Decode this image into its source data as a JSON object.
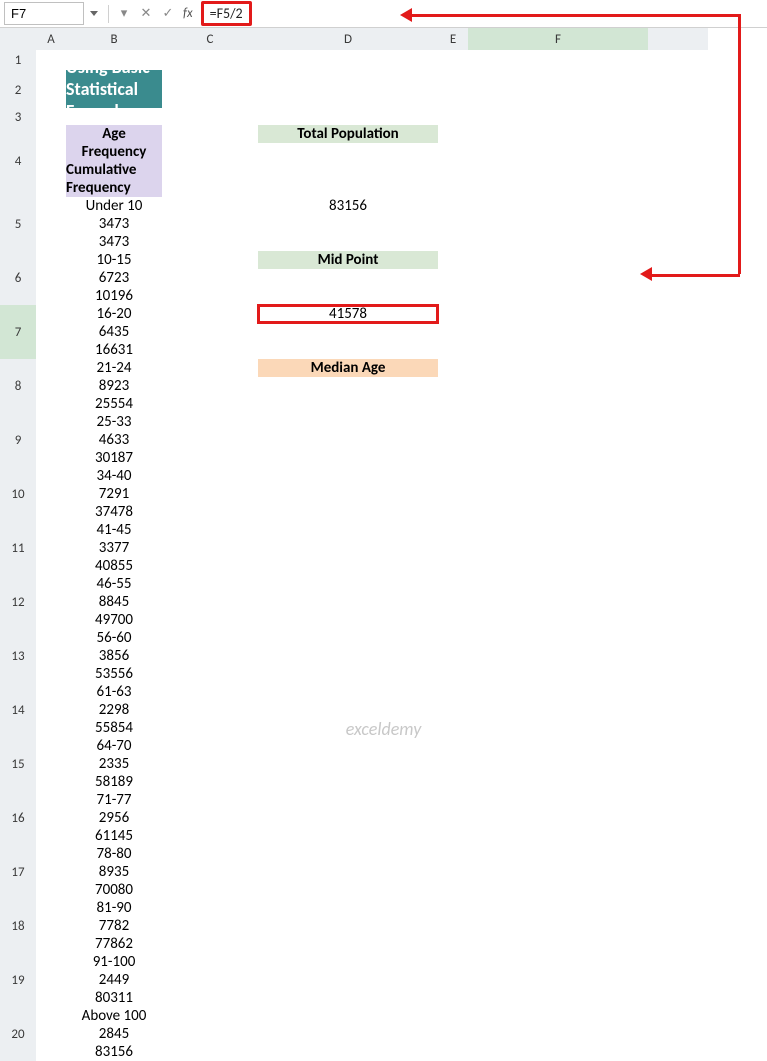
{
  "namebox": "F7",
  "formula": "=F5/2",
  "fx_label": "fx",
  "col_headers": [
    "A",
    "B",
    "C",
    "D",
    "E",
    "F"
  ],
  "row_headers": [
    "1",
    "2",
    "3",
    "4",
    "5",
    "6",
    "7",
    "8",
    "9",
    "10",
    "11",
    "12",
    "13",
    "14",
    "15",
    "16",
    "17",
    "18",
    "19",
    "20"
  ],
  "title": "Using Basic Statistical Formula",
  "table_headers": {
    "age": "Age",
    "freq": "Frequency",
    "cum": "Cumulative Frequency"
  },
  "rows": [
    {
      "age": "Under 10",
      "freq": "3473",
      "cum": "3473"
    },
    {
      "age": "10-15",
      "freq": "6723",
      "cum": "10196"
    },
    {
      "age": "16-20",
      "freq": "6435",
      "cum": "16631"
    },
    {
      "age": "21-24",
      "freq": "8923",
      "cum": "25554"
    },
    {
      "age": "25-33",
      "freq": "4633",
      "cum": "30187"
    },
    {
      "age": "34-40",
      "freq": "7291",
      "cum": "37478"
    },
    {
      "age": "41-45",
      "freq": "3377",
      "cum": "40855"
    },
    {
      "age": "46-55",
      "freq": "8845",
      "cum": "49700"
    },
    {
      "age": "56-60",
      "freq": "3856",
      "cum": "53556"
    },
    {
      "age": "61-63",
      "freq": "2298",
      "cum": "55854"
    },
    {
      "age": "64-70",
      "freq": "2335",
      "cum": "58189"
    },
    {
      "age": "71-77",
      "freq": "2956",
      "cum": "61145"
    },
    {
      "age": "78-80",
      "freq": "8935",
      "cum": "70080"
    },
    {
      "age": "81-90",
      "freq": "7782",
      "cum": "77862"
    },
    {
      "age": "91-100",
      "freq": "2449",
      "cum": "80311"
    },
    {
      "age": "Above 100",
      "freq": "2845",
      "cum": "83156"
    }
  ],
  "side": {
    "total_pop_label": "Total Population",
    "total_pop_value": "83156",
    "mid_point_label": "Mid Point",
    "mid_point_value": "41578",
    "median_age_label": "Median Age",
    "median_age_value": ""
  },
  "watermark": "exceldemy",
  "icons": {
    "check": "✓",
    "x": "✕",
    "dd": "▾"
  }
}
